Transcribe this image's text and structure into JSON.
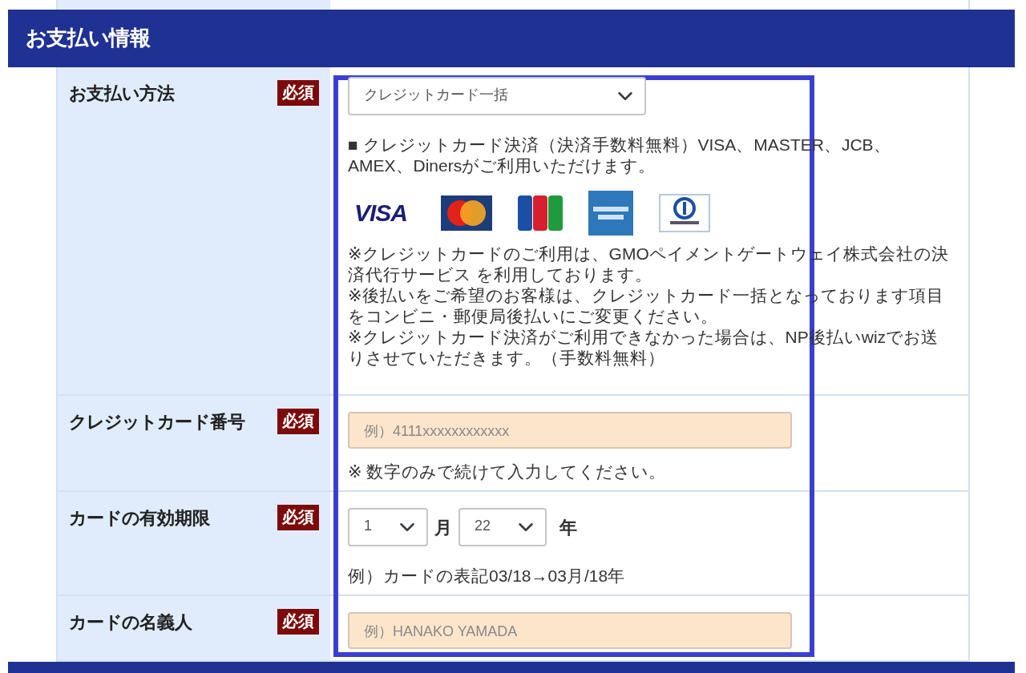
{
  "section": {
    "title": "お支払い情報"
  },
  "rows": [
    {
      "kind": "payment",
      "label": "お支払い方法",
      "badge": "必須",
      "select_value": "クレジットカード一括",
      "intro": "■ クレジットカード決済（決済手数料無料）VISA、MASTER、JCB、AMEX、Dinersがご利用いただけます。",
      "logos": [
        {
          "kind": "visa",
          "text": "VISA"
        },
        {
          "kind": "mastercard"
        },
        {
          "kind": "jcb"
        },
        {
          "kind": "amex"
        },
        {
          "kind": "diners"
        }
      ],
      "notes": [
        "※クレジットカードのご利用は、GMOペイメントゲートウェイ株式会社の決済代行サービス を利用しております。",
        "※後払いをご希望のお客様は、クレジットカード一括となっております項目をコンビニ・郵便局後払いにご変更ください。",
        "※クレジットカード決済がご利用できなかった場合は、NP後払いwizでお送りさせていただきます。（手数料無料）"
      ]
    },
    {
      "kind": "text",
      "label": "クレジットカード番号",
      "badge": "必須",
      "placeholder": "例）4111xxxxxxxxxxxx",
      "hint": "※ 数字のみで続けて入力してください。"
    },
    {
      "kind": "expiry",
      "label": "カードの有効期限",
      "badge": "必須",
      "month_value": "1",
      "month_unit": "月",
      "year_value": "22",
      "year_unit": "年",
      "hint": "例）カードの表記03/18→03月/18年"
    },
    {
      "kind": "text",
      "label": "カードの名義人",
      "badge": "必須",
      "placeholder": "例）HANAKO YAMADA"
    }
  ]
}
